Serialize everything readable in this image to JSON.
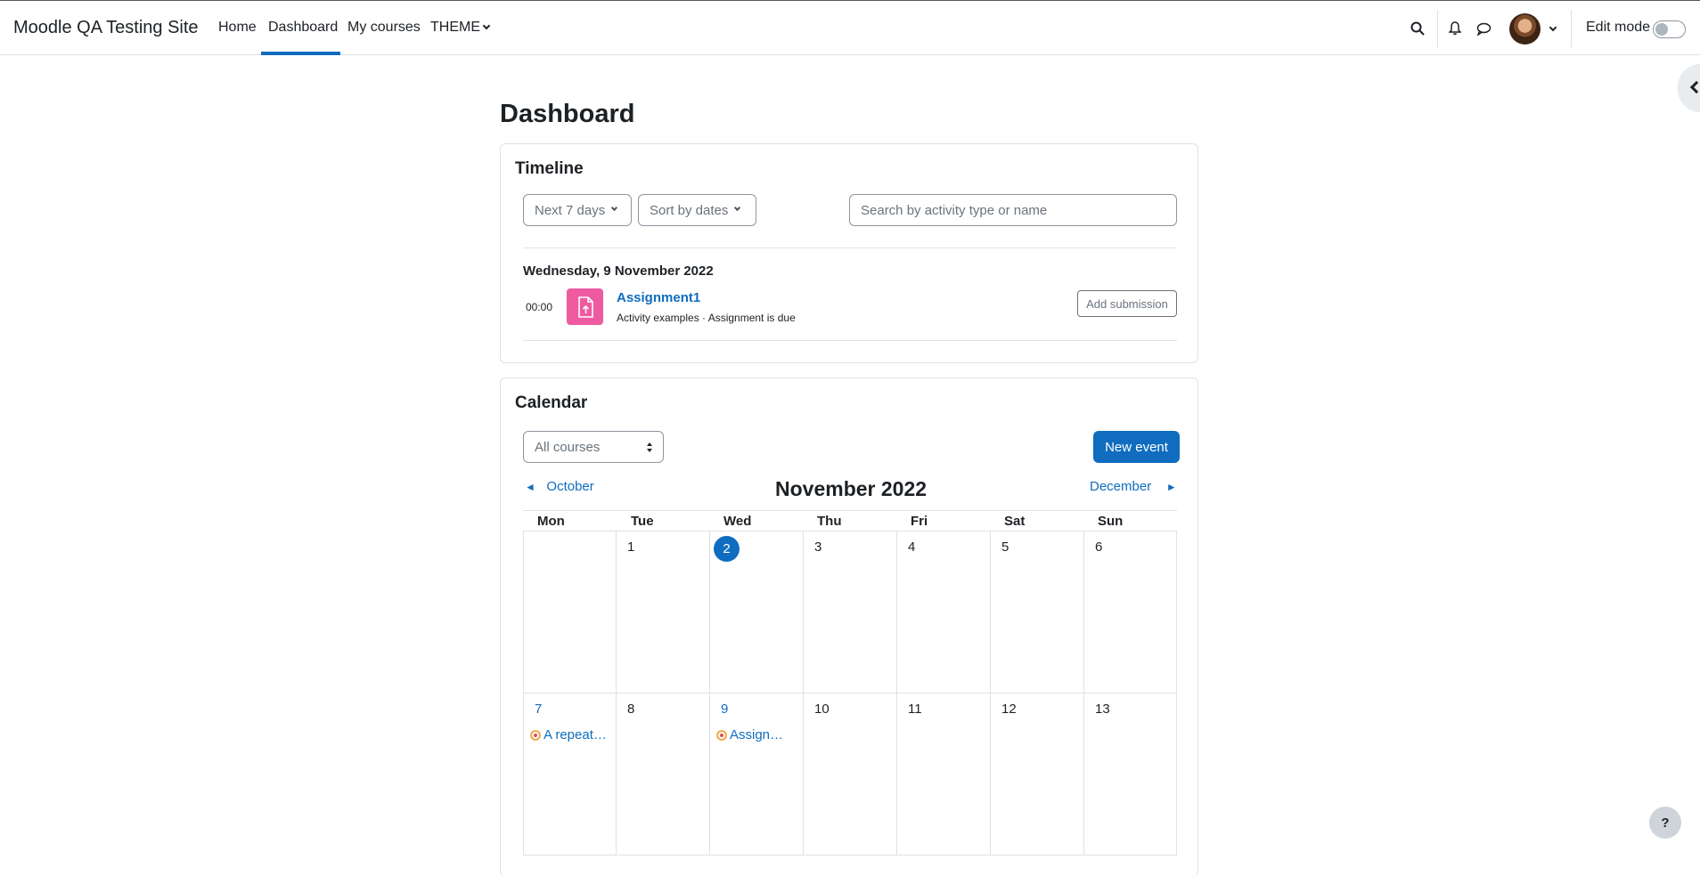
{
  "navbar": {
    "site_name": "Moodle QA Testing Site",
    "links": [
      {
        "label": "Home"
      },
      {
        "label": "Dashboard"
      },
      {
        "label": "My courses"
      },
      {
        "label": "THEME"
      }
    ],
    "active_link": "Dashboard",
    "edit_mode_label": "Edit mode",
    "edit_mode_on": false
  },
  "page": {
    "title": "Dashboard"
  },
  "timeline": {
    "title": "Timeline",
    "filter_label": "Next 7 days",
    "sort_label": "Sort by dates",
    "search_placeholder": "Search by activity type or name",
    "day_heading": "Wednesday, 9 November 2022",
    "event": {
      "time": "00:00",
      "name": "Assignment1",
      "subtitle": "Activity examples · Assignment is due",
      "action_label": "Add submission"
    }
  },
  "calendar": {
    "title": "Calendar",
    "course_select": "All courses",
    "new_event_label": "New event",
    "prev_month": "October",
    "next_month": "December",
    "month_title": "November 2022",
    "weekdays": [
      "Mon",
      "Tue",
      "Wed",
      "Thu",
      "Fri",
      "Sat",
      "Sun"
    ],
    "week1": [
      "",
      "1",
      "2",
      "3",
      "4",
      "5",
      "6"
    ],
    "week2": [
      "7",
      "8",
      "9",
      "10",
      "11",
      "12",
      "13"
    ],
    "today": "2",
    "events": {
      "mon7": "A repeat…",
      "wed9": "Assign…"
    }
  },
  "help_label": "?",
  "colors": {
    "primary": "#0f6cbf",
    "assign_icon": "#ef5ba1",
    "text": "#1d2125",
    "border": "#dee2e6"
  },
  "icons": [
    "search-icon",
    "bell-icon",
    "chat-icon",
    "avatar",
    "chevron-down-icon",
    "chevron-left-icon",
    "assignment-upload-icon",
    "event-dot-icon",
    "help-icon"
  ]
}
